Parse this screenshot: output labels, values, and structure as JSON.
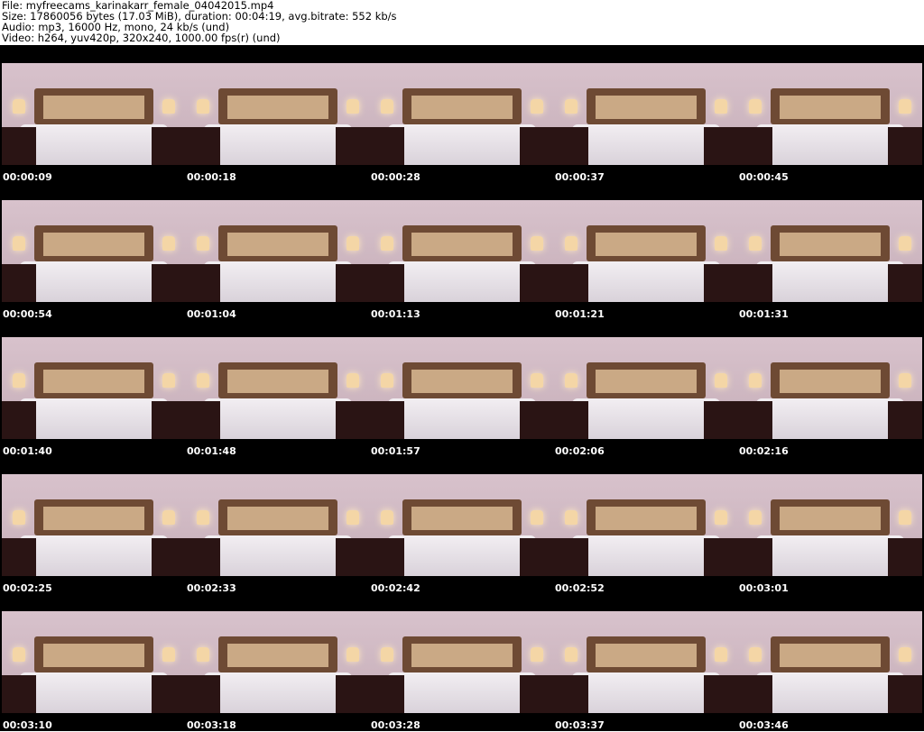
{
  "header": {
    "file": "File: myfreecams_karinakarr_female_04042015.mp4",
    "size": "Size: 17860056 bytes (17.03 MiB), duration: 00:04:19, avg.bitrate: 552 kb/s",
    "audio": "Audio: mp3, 16000 Hz, mono, 24 kb/s (und)",
    "video": "Video: h264, yuv420p, 320x240, 1000.00 fps(r) (und)"
  },
  "thumbnails": [
    "00:00:09",
    "00:00:18",
    "00:00:28",
    "00:00:37",
    "00:00:45",
    "00:00:54",
    "00:01:04",
    "00:01:13",
    "00:01:21",
    "00:01:31",
    "00:01:40",
    "00:01:48",
    "00:01:57",
    "00:02:06",
    "00:02:16",
    "00:02:25",
    "00:02:33",
    "00:02:42",
    "00:02:52",
    "00:03:01",
    "00:03:10",
    "00:03:18",
    "00:03:28",
    "00:03:37",
    "00:03:46"
  ]
}
